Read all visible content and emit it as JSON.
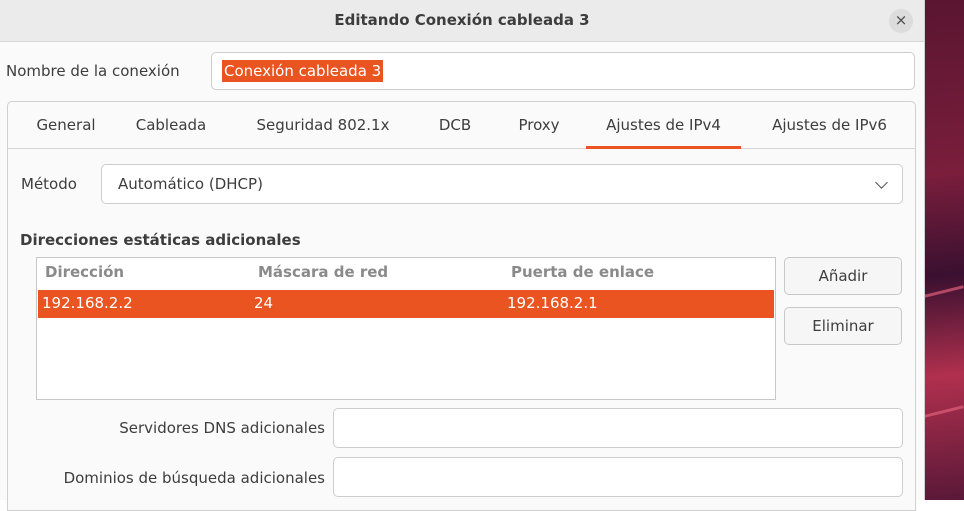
{
  "window": {
    "title": "Editando Conexión cableada 3",
    "close_glyph": "×"
  },
  "connection": {
    "name_label": "Nombre de la conexión",
    "name_value": "Conexión cableada 3"
  },
  "tabs": [
    {
      "label": "General"
    },
    {
      "label": "Cableada"
    },
    {
      "label": "Seguridad 802.1x"
    },
    {
      "label": "DCB"
    },
    {
      "label": "Proxy"
    },
    {
      "label": "Ajustes de IPv4"
    },
    {
      "label": "Ajustes de IPv6"
    }
  ],
  "active_tab": "Ajustes de IPv4",
  "ipv4": {
    "method_label": "Método",
    "method_value": "Automático (DHCP)",
    "section_title": "Direcciones estáticas adicionales",
    "columns": [
      "Dirección",
      "Máscara de red",
      "Puerta de enlace"
    ],
    "rows": [
      {
        "address": "192.168.2.2",
        "netmask": "24",
        "gateway": "192.168.2.1",
        "selected": true
      }
    ],
    "add_button": "Añadir",
    "remove_button": "Eliminar",
    "dns_label": "Servidores DNS adicionales",
    "dns_value": "",
    "search_domains_label": "Dominios de búsqueda adicionales",
    "search_domains_value": ""
  },
  "colors": {
    "accent": "#e95420",
    "titlebar": "#ebebeb",
    "background": "#fafafa"
  }
}
